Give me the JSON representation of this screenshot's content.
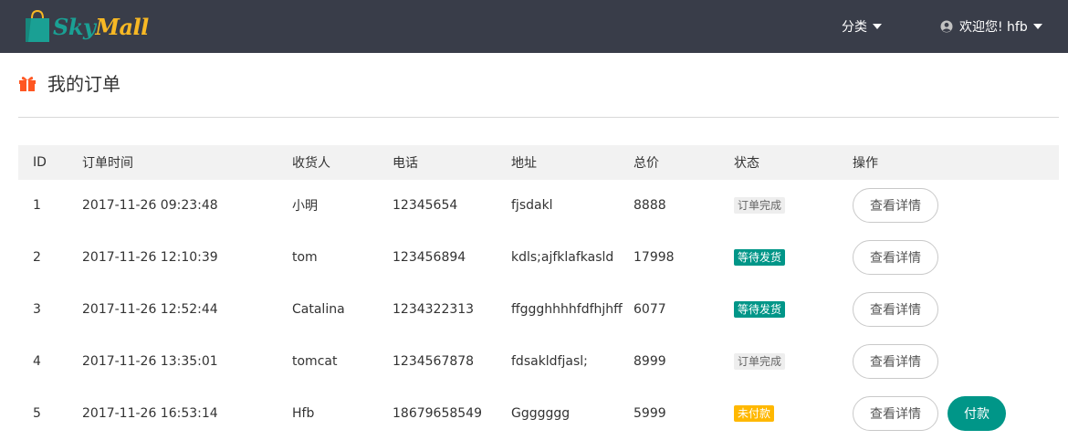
{
  "nav": {
    "logo_text_1": "Sky",
    "logo_text_2": "Mall",
    "category_label": "分类",
    "user_label": "欢迎您! hfb"
  },
  "page": {
    "title": "我的订单"
  },
  "table": {
    "headers": [
      "ID",
      "订单时间",
      "收货人",
      "电话",
      "地址",
      "总价",
      "状态",
      "操作"
    ],
    "rows": [
      {
        "id": "1",
        "time": "2017-11-26 09:23:48",
        "name": "小明",
        "phone": "12345654",
        "address": "fjsdakl",
        "price": "8888",
        "status": "订单完成",
        "status_type": "gray",
        "action": "查看详情"
      },
      {
        "id": "2",
        "time": "2017-11-26 12:10:39",
        "name": "tom",
        "phone": "123456894",
        "address": "kdls;ajfklafkasld",
        "price": "17998",
        "status": "等待发货",
        "status_type": "green",
        "action": "查看详情"
      },
      {
        "id": "3",
        "time": "2017-11-26 12:52:44",
        "name": "Catalina",
        "phone": "1234322313",
        "address": "ffggghhhhfdfhjhff",
        "price": "6077",
        "status": "等待发货",
        "status_type": "green",
        "action": "查看详情"
      },
      {
        "id": "4",
        "time": "2017-11-26 13:35:01",
        "name": "tomcat",
        "phone": "1234567878",
        "address": "fdsakldfjasl;",
        "price": "8999",
        "status": "订单完成",
        "status_type": "gray",
        "action": "查看详情"
      },
      {
        "id": "5",
        "time": "2017-11-26 16:53:14",
        "name": "Hfb",
        "phone": "18679658549",
        "address": "Ggggggg",
        "price": "5999",
        "status": "未付款",
        "status_type": "orange",
        "action": "查看详情",
        "pay": "付款"
      }
    ]
  },
  "colors": {
    "navbar": "#393d49",
    "primary": "#009688",
    "warning": "#ffb800",
    "accent_icon": "#ff5722"
  },
  "icons": {
    "logo": "shopping-bag-icon",
    "category_caret": "caret-down-icon",
    "user": "user-circle-icon",
    "title": "gift-icon"
  }
}
